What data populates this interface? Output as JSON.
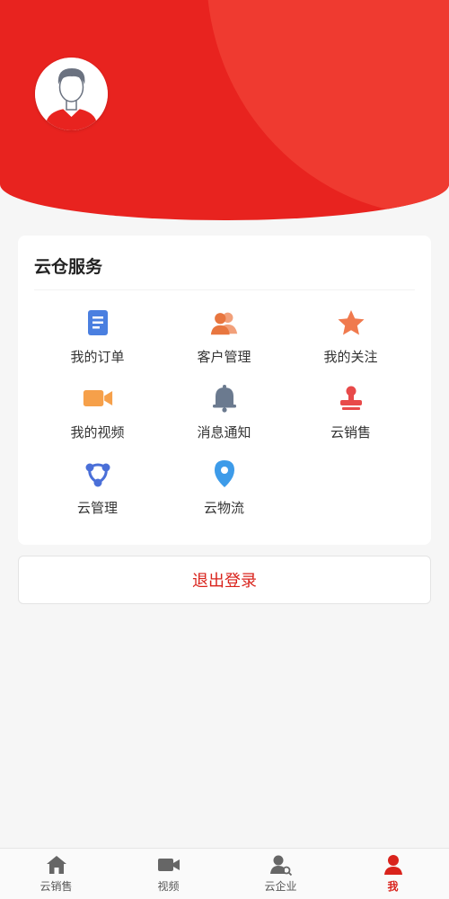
{
  "colors": {
    "brand_red": "#e8231f",
    "logout_text": "#d9231c",
    "nav_inactive": "#666666"
  },
  "profile": {
    "avatar_icon": "user-avatar-icon"
  },
  "services": {
    "title": "云仓服务",
    "items": [
      {
        "label": "我的订单",
        "icon": "document-icon",
        "color": "#4a7fe0"
      },
      {
        "label": "客户管理",
        "icon": "customers-icon",
        "color": "#f08a52"
      },
      {
        "label": "我的关注",
        "icon": "star-icon",
        "color": "#f07a4e"
      },
      {
        "label": "我的视频",
        "icon": "video-camera-icon",
        "color": "#f6a04a"
      },
      {
        "label": "消息通知",
        "icon": "bell-icon",
        "color": "#6b7a8f"
      },
      {
        "label": "云销售",
        "icon": "stamp-icon",
        "color": "#e84a4a"
      },
      {
        "label": "云管理",
        "icon": "network-icon",
        "color": "#4a6fd8"
      },
      {
        "label": "云物流",
        "icon": "location-pin-icon",
        "color": "#3d9be9"
      }
    ]
  },
  "logout": {
    "label": "退出登录"
  },
  "bottom_nav": {
    "items": [
      {
        "label": "云销售",
        "icon": "home-icon",
        "active": false
      },
      {
        "label": "视频",
        "icon": "video-icon",
        "active": false
      },
      {
        "label": "云企业",
        "icon": "user-search-icon",
        "active": false
      },
      {
        "label": "我",
        "icon": "person-icon",
        "active": true
      }
    ]
  }
}
